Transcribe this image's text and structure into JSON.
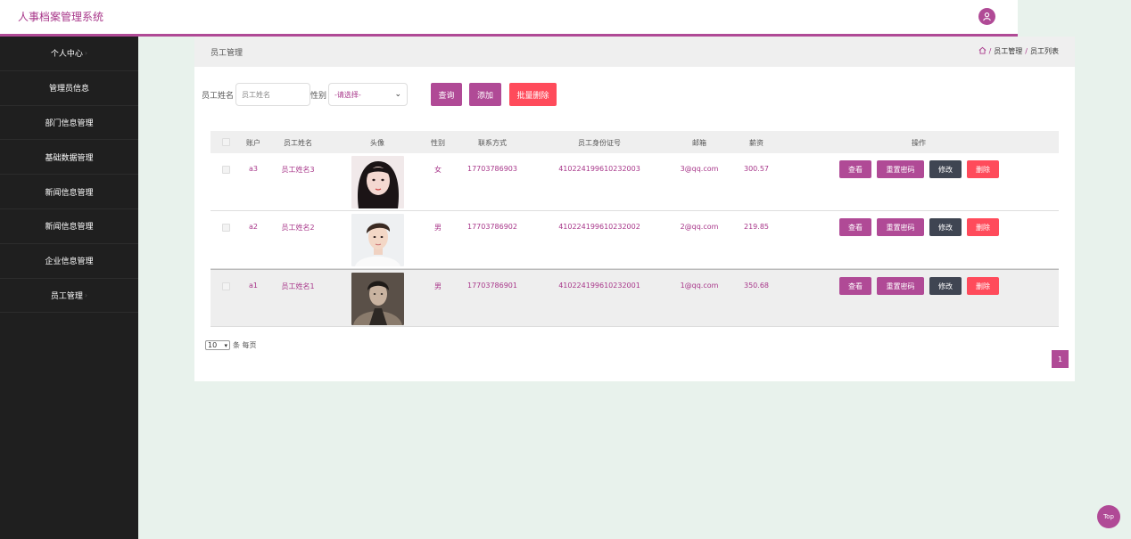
{
  "header": {
    "app_title": "人事档案管理系统",
    "user_icon": "user-icon"
  },
  "sidebar": {
    "items": [
      {
        "label": "个人中心",
        "chevron": true
      },
      {
        "label": "管理员信息"
      },
      {
        "label": "部门信息管理"
      },
      {
        "label": "基础数据管理"
      },
      {
        "label": "新闻信息管理"
      },
      {
        "label": "新闻信息管理"
      },
      {
        "label": "企业信息管理"
      },
      {
        "label": "员工管理",
        "chevron": true
      }
    ]
  },
  "panel": {
    "title": "员工管理",
    "breadcrumb": [
      "员工管理",
      "员工列表"
    ]
  },
  "search": {
    "name_label": "员工姓名",
    "name_placeholder": "员工姓名",
    "sex_label": "性别",
    "sex_selected": "-请选择-",
    "query_label": "查询",
    "add_label": "添加",
    "batch_delete_label": "批量删除"
  },
  "table": {
    "headers": [
      "账户",
      "员工姓名",
      "头像",
      "性别",
      "联系方式",
      "员工身份证号",
      "邮箱",
      "薪资",
      "操作"
    ],
    "rows": [
      {
        "account": "a3",
        "name": "员工姓名3",
        "sex": "女",
        "phone": "17703786903",
        "id_card": "410224199610232003",
        "email": "3@qq.com",
        "salary": "300.57"
      },
      {
        "account": "a2",
        "name": "员工姓名2",
        "sex": "男",
        "phone": "17703786902",
        "id_card": "410224199610232002",
        "email": "2@qq.com",
        "salary": "219.85"
      },
      {
        "account": "a1",
        "name": "员工姓名1",
        "sex": "男",
        "phone": "17703786901",
        "id_card": "410224199610232001",
        "email": "1@qq.com",
        "salary": "350.68"
      }
    ],
    "ops": {
      "view": "查看",
      "reset": "重置密码",
      "edit": "修改",
      "delete": "删除"
    }
  },
  "pagination": {
    "page_size": "10",
    "page_size_suffix": "条 每页",
    "current_page": "1"
  },
  "top_button": "Top",
  "colors": {
    "accent": "#b04a96",
    "danger": "#ff4b5b",
    "dark": "#3f4552",
    "sidebar": "#1f1f1f"
  }
}
